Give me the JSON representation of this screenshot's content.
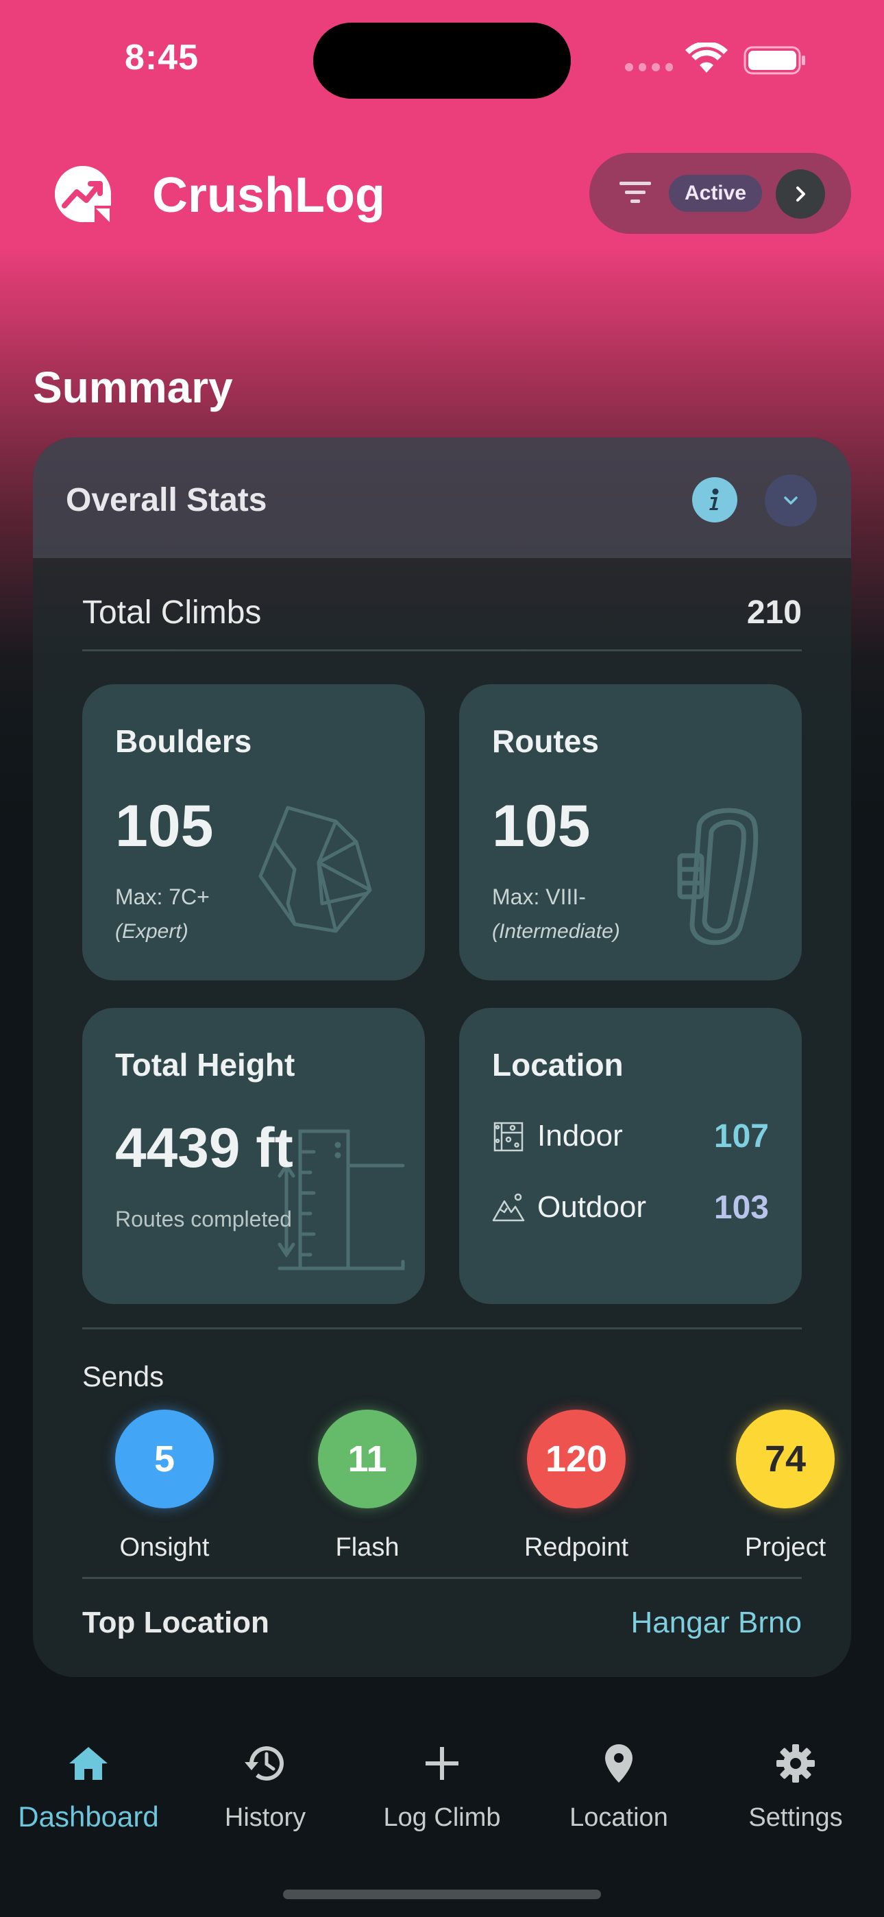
{
  "status_bar": {
    "time": "8:45"
  },
  "header": {
    "app_title": "CrushLog",
    "filter_chip": "Active"
  },
  "summary": {
    "title": "Summary",
    "card_title": "Overall Stats",
    "total_climbs": {
      "label": "Total Climbs",
      "value": "210"
    },
    "boulders": {
      "title": "Boulders",
      "count": "105",
      "max": "Max: 7C+",
      "level": "(Expert)"
    },
    "routes": {
      "title": "Routes",
      "count": "105",
      "max": "Max: VIII-",
      "level": "(Intermediate)"
    },
    "height": {
      "title": "Total Height",
      "value": "4439 ft",
      "sub": "Routes completed"
    },
    "location": {
      "title": "Location",
      "indoor": {
        "label": "Indoor",
        "value": "107",
        "color": "#7ecfe0"
      },
      "outdoor": {
        "label": "Outdoor",
        "value": "103",
        "color": "#b8c4ec"
      }
    },
    "sends": {
      "title": "Sends",
      "items": [
        {
          "label": "Onsight",
          "value": "5",
          "color": "#42a5f5"
        },
        {
          "label": "Flash",
          "value": "11",
          "color": "#66bb6a"
        },
        {
          "label": "Redpoint",
          "value": "120",
          "color": "#ef5350"
        },
        {
          "label": "Project",
          "value": "74",
          "color": "#fdd835"
        }
      ]
    },
    "top_location": {
      "label": "Top Location",
      "value": "Hangar Brno"
    }
  },
  "nav": {
    "items": [
      {
        "label": "Dashboard",
        "icon": "home-icon",
        "active": true
      },
      {
        "label": "History",
        "icon": "history-icon"
      },
      {
        "label": "Log Climb",
        "icon": "plus-icon"
      },
      {
        "label": "Location",
        "icon": "location-pin-icon"
      },
      {
        "label": "Settings",
        "icon": "gear-icon"
      }
    ]
  },
  "colors": {
    "brand": "#ea3f7a",
    "accent": "#6cc6dc",
    "card": "#30474b"
  }
}
